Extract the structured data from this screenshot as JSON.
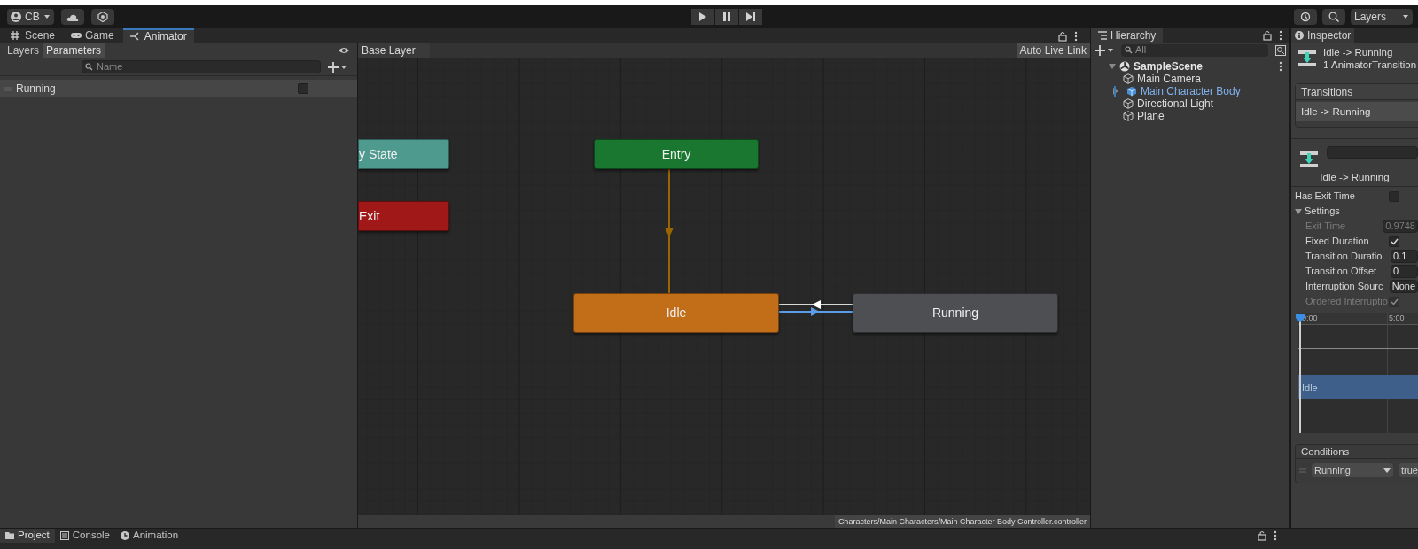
{
  "toolbar": {
    "account": "CB",
    "layers_dropdown": "Layers"
  },
  "editor_tabs": [
    {
      "label": "Scene",
      "selected": false
    },
    {
      "label": "Game",
      "selected": false
    },
    {
      "label": "Animator",
      "selected": true
    }
  ],
  "parameters_panel": {
    "tabs": [
      {
        "label": "Layers",
        "selected": false
      },
      {
        "label": "Parameters",
        "selected": true
      }
    ],
    "search": {
      "placeholder": "Name"
    },
    "parameters": [
      {
        "name": "Running",
        "checked": false
      }
    ]
  },
  "graph": {
    "breadcrumb": "Base Layer",
    "live_link_button": "Auto Live Link",
    "path": "Characters/Main Characters/Main Character Body Controller.controller",
    "states": [
      {
        "label": "y State",
        "color": "#4f9a8f"
      },
      {
        "label": "Exit",
        "color": "#a01818"
      },
      {
        "label": "Entry",
        "color": "#19772f"
      },
      {
        "label": "Idle",
        "color": "#c26e18"
      },
      {
        "label": "Running",
        "color": "#4d4f53"
      }
    ]
  },
  "hierarchy": {
    "title": "Hierarchy",
    "search": {
      "placeholder": "All"
    },
    "scene": {
      "name": "SampleScene",
      "expanded": true,
      "children": [
        {
          "name": "Main Camera",
          "selected": false,
          "has_children": false
        },
        {
          "name": "Main Character Body",
          "selected": true,
          "has_children": true
        },
        {
          "name": "Directional Light",
          "selected": false,
          "has_children": false
        },
        {
          "name": "Plane",
          "selected": false,
          "has_children": false
        }
      ]
    }
  },
  "inspector": {
    "title": "Inspector",
    "header_title": "Idle -> Running",
    "header_subtitle": "1 AnimatorTransition",
    "transitions_heading": "Transitions",
    "transitions": [
      {
        "label": "Idle -> Running",
        "selected": true
      }
    ],
    "transition_name": "Idle -> Running",
    "properties": [
      {
        "kind": "checkbox",
        "label": "Has Exit Time",
        "checked": false,
        "disabled": false
      },
      {
        "kind": "foldout",
        "label": "Settings",
        "expanded": true,
        "children": [
          {
            "kind": "field",
            "label": "Exit Time",
            "value": "0.9748",
            "disabled": true
          },
          {
            "kind": "checkbox",
            "label": "Fixed Duration",
            "checked": true,
            "disabled": false
          },
          {
            "kind": "field",
            "label": "Transition Duratio",
            "value": "0.1",
            "disabled": false
          },
          {
            "kind": "field",
            "label": "Transition Offset",
            "value": "0",
            "disabled": false
          },
          {
            "kind": "field",
            "label": "Interruption Sourc",
            "value": "None",
            "disabled": false
          },
          {
            "kind": "checkbox",
            "label": "Ordered Interruptio",
            "checked": true,
            "disabled": true
          }
        ]
      }
    ],
    "timeline": {
      "ticks": [
        "0:00",
        "5:00"
      ],
      "clip": "Idle"
    },
    "conditions_heading": "Conditions",
    "conditions": [
      {
        "parameter": "Running",
        "value": "true"
      }
    ]
  },
  "bottom_tabs": [
    {
      "label": "Project",
      "selected": true
    },
    {
      "label": "Console",
      "selected": false
    },
    {
      "label": "Animation",
      "selected": false
    }
  ]
}
